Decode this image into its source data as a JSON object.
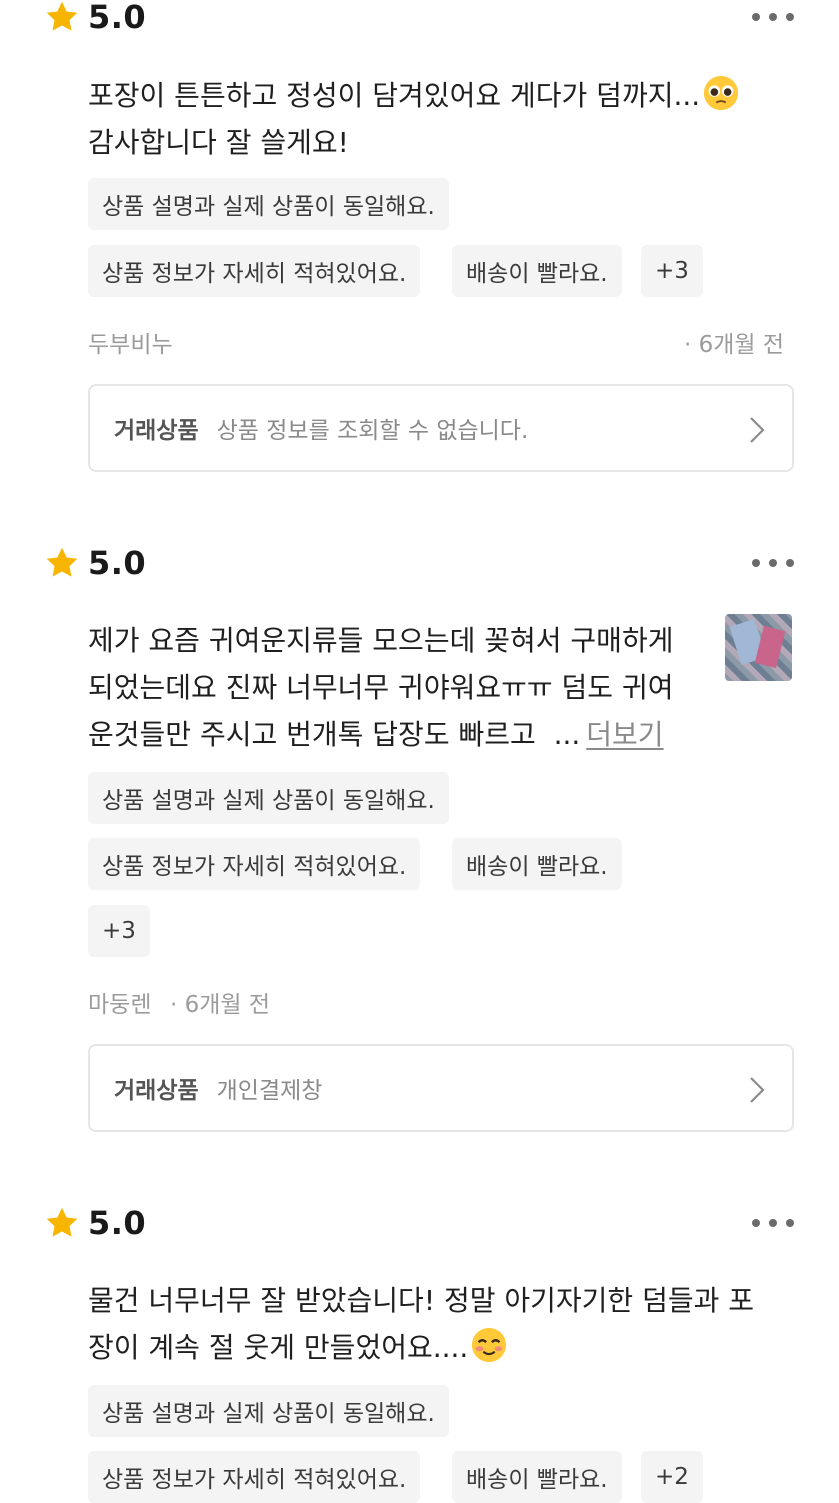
{
  "reviews": [
    {
      "rating": "5.0",
      "text_lines": [
        "포장이 튼튼하고 정성이 담겨있어요 게다가 덤까지...",
        "감사합니다 잘 쓸게요!"
      ],
      "emoji": "pleading-face-emoji",
      "tags": [
        "상품 설명과 실제 상품이 동일해요.",
        "상품 정보가 자세히 적혀있어요.",
        "배송이 빨라요.",
        "+3"
      ],
      "author": "두부비누",
      "time": "· 6개월 전",
      "product_label": "거래상품",
      "product_value": "상품 정보를 조회할 수 없습니다."
    },
    {
      "rating": "5.0",
      "text_lines": [
        "제가 요즘 귀여운지류들 모으는데 꽂혀서 구매하게",
        "되었는데요 진짜 너무너무 귀야워요ㅠㅠ 덤도 귀여",
        "운것들만 주시고 번개톡 답장도 빠르고"
      ],
      "ellipsis": "...",
      "see_more": "더보기",
      "tags": [
        "상품 설명과 실제 상품이 동일해요.",
        "상품 정보가 자세히 적혀있어요.",
        "배송이 빨라요.",
        "+3"
      ],
      "author": "마둥렌",
      "time": "· 6개월 전",
      "product_label": "거래상품",
      "product_value": "개인결제창"
    },
    {
      "rating": "5.0",
      "text_lines": [
        "물건 너무너무 잘 받았습니다! 정말 아기자기한 덤들과 포",
        "장이 계속 절 웃게 만들었어요...."
      ],
      "emoji": "smiling-face-emoji",
      "tags": [
        "상품 설명과 실제 상품이 동일해요.",
        "상품 정보가 자세히 적혀있어요.",
        "배송이 빨라요.",
        "+2"
      ]
    }
  ],
  "colors": {
    "star": "#F7B500",
    "tag_bg": "#F4F4F4",
    "meta": "#9B9B9B"
  }
}
